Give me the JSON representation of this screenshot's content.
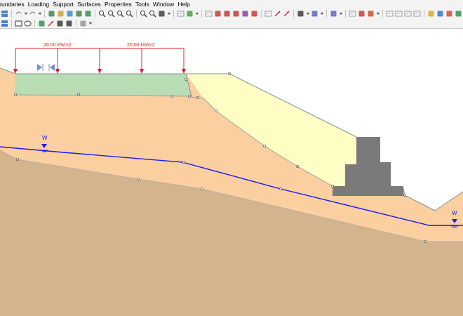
{
  "menu": [
    "Boundaries",
    "Loading",
    "Support",
    "Surfaces",
    "Properties",
    "Tools",
    "Window",
    "Help"
  ],
  "toolbar_row1": [
    {
      "icon": "grid-icon",
      "color": "#2a6fbe"
    },
    "sep",
    {
      "icon": "undo-icon",
      "color": "#8a8a8a"
    },
    {
      "icon": "dropdown-arrow-icon",
      "color": "#555555"
    },
    {
      "icon": "redo-icon",
      "color": "#8a8a8a"
    },
    {
      "icon": "dropdown-arrow-icon",
      "color": "#555555"
    },
    "sep",
    {
      "icon": "compute-icon",
      "color": "#3a7d3a"
    },
    {
      "icon": "interpret-icon",
      "color": "#c8a030"
    },
    {
      "icon": "display-icon",
      "color": "#2e8bc0"
    },
    {
      "icon": "info-icon",
      "color": "#3a7d3a"
    },
    {
      "icon": "chart-icon",
      "color": "#2a8a4a"
    },
    "sep",
    {
      "icon": "zoom-in-icon",
      "color": "#333333"
    },
    {
      "icon": "zoom-out-icon",
      "color": "#333333"
    },
    {
      "icon": "zoom-window-icon",
      "color": "#333333"
    },
    {
      "icon": "zoom-extents-icon",
      "color": "#333333"
    },
    "sep",
    {
      "icon": "zoom-all-icon",
      "color": "#333333"
    },
    {
      "icon": "zoom-previous-icon",
      "color": "#333333"
    },
    {
      "icon": "pan-icon",
      "color": "#333333"
    },
    {
      "icon": "dropdown-arrow-icon",
      "color": "#555555"
    },
    "sep",
    {
      "icon": "external-boundary-icon",
      "color": "#909090"
    },
    {
      "icon": "material-boundary-icon",
      "color": "#3a9a3a"
    },
    {
      "icon": "dropdown-arrow-icon",
      "color": "#555555"
    },
    "sep",
    {
      "icon": "water-table-icon",
      "color": "#909090"
    },
    {
      "icon": "piezo-line-icon",
      "color": "#c03030"
    },
    {
      "icon": "add-vertex-icon",
      "color": "#c03030"
    },
    {
      "icon": "delete-vertex-icon",
      "color": "#c03030"
    },
    {
      "icon": "move-vertex-icon",
      "color": "#7a3a9a"
    },
    {
      "icon": "edit-vertex-icon",
      "color": "#c03030"
    },
    "sep",
    {
      "icon": "select-icon",
      "color": "#909090"
    },
    {
      "icon": "distributed-load-icon",
      "color": "#c03030"
    },
    {
      "icon": "point-load-icon",
      "color": "#c03030"
    },
    "sep",
    {
      "icon": "support-icon",
      "color": "#333333"
    },
    {
      "icon": "dropdown-arrow-icon",
      "color": "#555555"
    },
    {
      "icon": "anchor-icon",
      "color": "#5a5ac0"
    },
    {
      "icon": "dropdown-arrow-icon",
      "color": "#555555"
    },
    "sep",
    {
      "icon": "grid-search-icon",
      "color": "#5a5ac0"
    },
    {
      "icon": "dropdown-arrow-icon",
      "color": "#555555"
    },
    "sep",
    {
      "icon": "properties-icon",
      "color": "#909090"
    },
    {
      "icon": "assign-icon",
      "color": "#c03030"
    },
    {
      "icon": "material-icon",
      "color": "#d04020"
    },
    {
      "icon": "dropdown-arrow-icon",
      "color": "#555555"
    },
    "sep",
    {
      "icon": "query-icon",
      "color": "#909090"
    },
    {
      "icon": "graph-icon",
      "color": "#909090"
    },
    {
      "icon": "export-icon",
      "color": "#909090"
    },
    {
      "icon": "report-icon",
      "color": "#909090"
    },
    "sep",
    {
      "icon": "open-folder-icon",
      "color": "#d8a020"
    },
    {
      "icon": "save-icon",
      "color": "#2a6fbe"
    },
    {
      "icon": "print-icon",
      "color": "#d04020"
    },
    {
      "icon": "settings-icon",
      "color": "#2a8a4a"
    }
  ],
  "toolbar_row2": [
    {
      "icon": "view-options-icon",
      "color": "#2a6fbe"
    },
    "sep",
    {
      "icon": "rectangle-icon",
      "color": "#333333"
    },
    {
      "icon": "ellipse-icon",
      "color": "#333333"
    },
    "sep",
    {
      "icon": "text-box-icon",
      "color": "#2a8a4a"
    },
    {
      "icon": "arrow-icon",
      "color": "#c03030"
    },
    {
      "icon": "dimension-icon",
      "color": "#333333"
    },
    {
      "icon": "angle-icon",
      "color": "#333333"
    },
    "sep",
    {
      "icon": "pen-icon",
      "color": "#909090"
    },
    {
      "icon": "dropdown-arrow-icon",
      "color": "#555555"
    }
  ],
  "model": {
    "loads": [
      {
        "label": "20.00 kN/m2"
      },
      {
        "label": "20.00 kN/m2"
      }
    ],
    "water_labels": [
      "W",
      "W"
    ],
    "colors": {
      "foundation_soil": "#d4b48c",
      "slope_soil": "#fccfa0",
      "fill_soil": "#fdfdc4",
      "top_layer": "#b8dcb4",
      "wall": "#7a7a7a",
      "load": "#e02020",
      "water": "#1a1aee"
    }
  }
}
